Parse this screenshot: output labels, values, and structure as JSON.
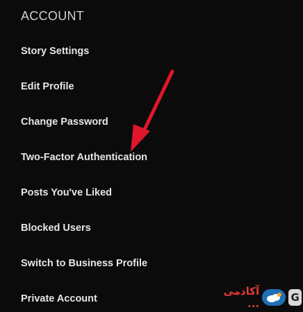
{
  "section": {
    "title": "ACCOUNT"
  },
  "menu": {
    "items": [
      {
        "label": "Story Settings"
      },
      {
        "label": "Edit Profile"
      },
      {
        "label": "Change Password"
      },
      {
        "label": "Two-Factor Authentication"
      },
      {
        "label": "Posts You've Liked"
      },
      {
        "label": "Blocked Users"
      },
      {
        "label": "Switch to Business Profile"
      },
      {
        "label": "Private Account"
      }
    ]
  },
  "annotation": {
    "arrow_color": "#e0162b"
  },
  "watermark": {
    "text": "آکادمی ...",
    "logo_letter": "G",
    "text_color": "#e53935",
    "badge_color": "#1e6fb5"
  }
}
